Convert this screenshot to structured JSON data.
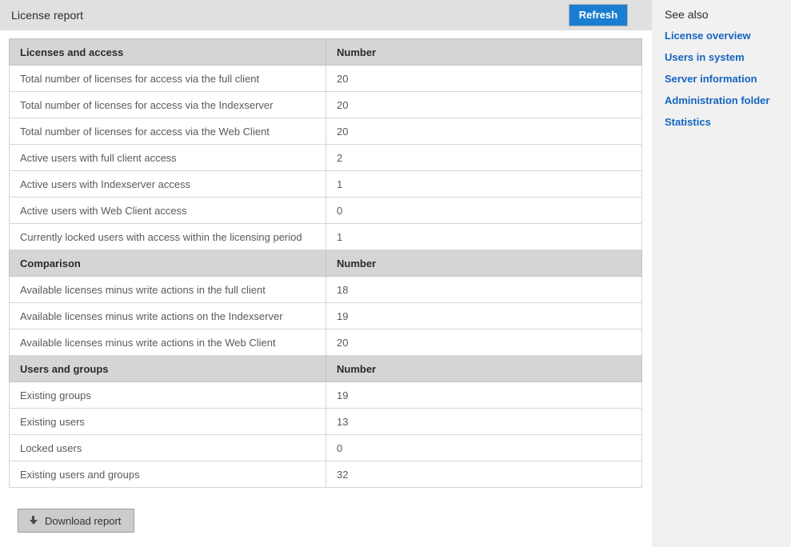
{
  "header": {
    "title": "License report",
    "refresh_label": "Refresh"
  },
  "table": {
    "sections": [
      {
        "header_label": "Licenses and access",
        "header_value": "Number",
        "rows": [
          {
            "label": "Total number of licenses for access via the full client",
            "value": "20"
          },
          {
            "label": "Total number of licenses for access via the Indexserver",
            "value": "20"
          },
          {
            "label": "Total number of licenses for access via the Web Client",
            "value": "20"
          },
          {
            "label": "Active users with full client access",
            "value": "2"
          },
          {
            "label": "Active users with Indexserver access",
            "value": "1"
          },
          {
            "label": "Active users with Web Client access",
            "value": "0"
          },
          {
            "label": "Currently locked users with access within the licensing period",
            "value": "1"
          }
        ]
      },
      {
        "header_label": "Comparison",
        "header_value": "Number",
        "rows": [
          {
            "label": "Available licenses minus write actions in the full client",
            "value": "18"
          },
          {
            "label": "Available licenses minus write actions on the Indexserver",
            "value": "19"
          },
          {
            "label": "Available licenses minus write actions in the Web Client",
            "value": "20"
          }
        ]
      },
      {
        "header_label": "Users and groups",
        "header_value": "Number",
        "rows": [
          {
            "label": "Existing groups",
            "value": "19"
          },
          {
            "label": "Existing users",
            "value": "13"
          },
          {
            "label": "Locked users",
            "value": "0"
          },
          {
            "label": "Existing users and groups",
            "value": "32"
          }
        ]
      }
    ]
  },
  "footer": {
    "download_label": "Download report",
    "download_icon": "download-arrow-icon"
  },
  "sidebar": {
    "title": "See also",
    "links": [
      {
        "label": "License overview"
      },
      {
        "label": "Users in system"
      },
      {
        "label": "Server information"
      },
      {
        "label": "Administration folder"
      },
      {
        "label": "Statistics"
      }
    ]
  },
  "colors": {
    "topbar_bg": "#e0e0e0",
    "accent_blue": "#1a7ed0",
    "link_blue": "#1565c0",
    "table_header_bg": "#d5d5d5",
    "sidebar_bg": "#f1f1f1"
  }
}
